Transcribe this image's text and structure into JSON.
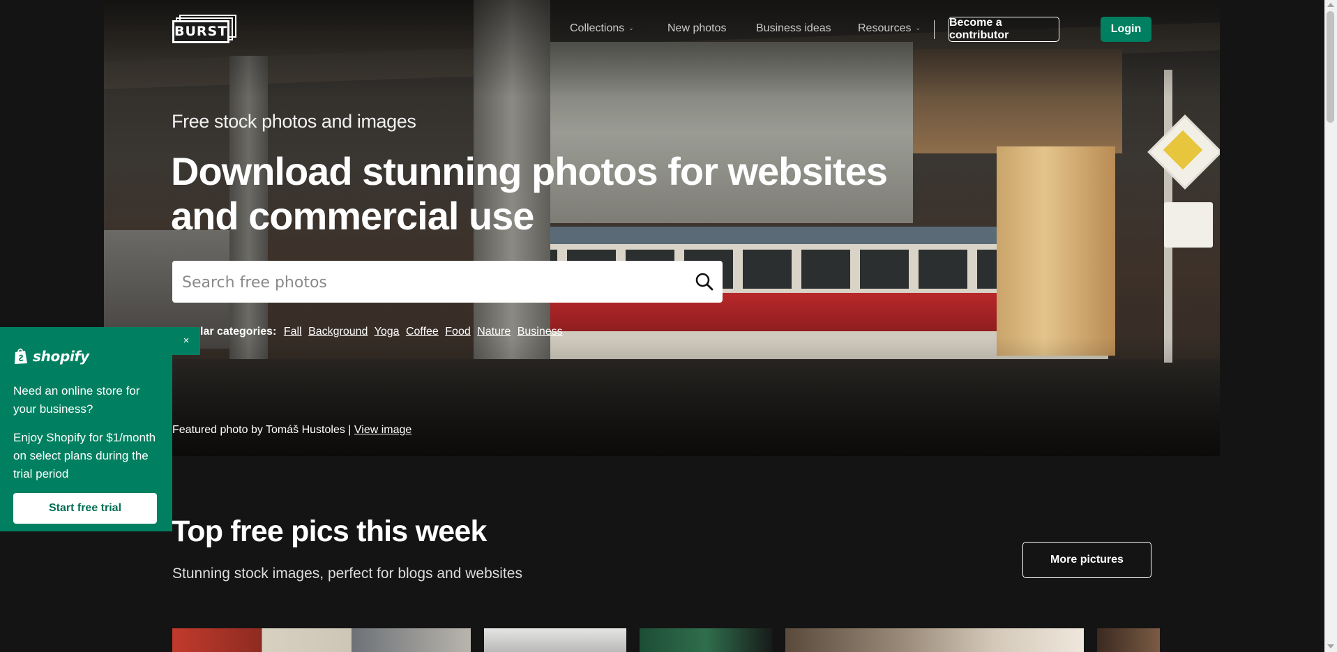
{
  "header": {
    "logo_text": "BURST",
    "nav": [
      {
        "label": "Collections",
        "has_dropdown": true
      },
      {
        "label": "New photos",
        "has_dropdown": false
      },
      {
        "label": "Business ideas",
        "has_dropdown": false
      },
      {
        "label": "Resources",
        "has_dropdown": true
      }
    ],
    "contributor_label": "Become a contributor",
    "login_label": "Login"
  },
  "hero": {
    "subtitle": "Free stock photos and images",
    "title": "Download stunning photos for websites and commercial use",
    "search_placeholder": "Search free photos",
    "popular_label": "Popular categories:",
    "categories": [
      "Fall",
      "Background",
      "Yoga",
      "Coffee",
      "Food",
      "Nature",
      "Business"
    ],
    "featured_text": "Featured photo by Tomáš Hustoles |",
    "featured_link": "View image"
  },
  "section": {
    "title": "Top free pics this week",
    "subtitle": "Stunning stock images, perfect for blogs and websites",
    "more_label": "More pictures"
  },
  "promo": {
    "brand": "shopify",
    "question": "Need an online store for your business?",
    "offer": "Enjoy Shopify for $1/month on select plans during the trial period",
    "cta": "Start free trial",
    "close_symbol": "×"
  },
  "colors": {
    "accent": "#008060",
    "background": "#141414"
  }
}
